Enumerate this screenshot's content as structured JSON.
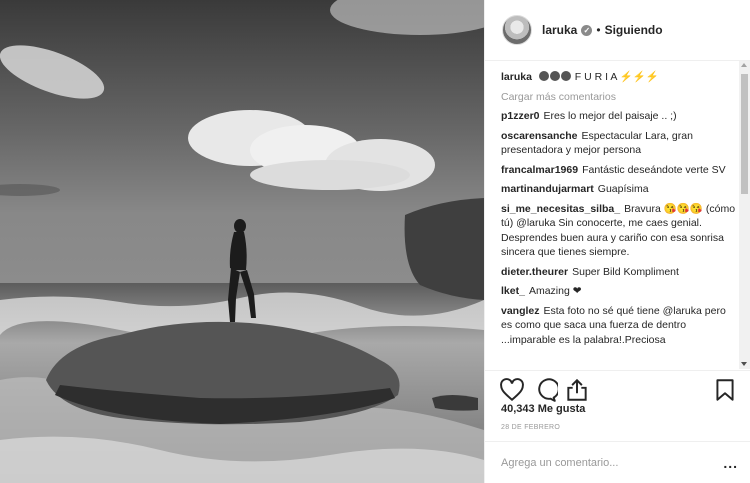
{
  "post": {
    "username": "laruka",
    "verified_icon": "verified-badge-icon",
    "separator": "•",
    "follow_status": "Siguiendo",
    "caption": "F U R I A",
    "caption_prefix_icons": [
      "dark-circle-emoji-icon",
      "dark-circle-emoji-icon",
      "dark-circle-emoji-icon"
    ],
    "caption_suffix_icons": [
      "lightning-emoji-icon",
      "lightning-emoji-icon",
      "lightning-emoji-icon"
    ],
    "load_more": "Cargar más comentarios",
    "comments": [
      {
        "user": "p1zzer0",
        "text": "Eres lo mejor del paisaje .. ;)"
      },
      {
        "user": "oscarensanche",
        "text": "Espectacular Lara, gran presentadora y mejor persona"
      },
      {
        "user": "francalmar1969",
        "text": "Fantástic deseándote verte SV"
      },
      {
        "user": "martinandujarmart",
        "text": "Guapísima"
      },
      {
        "user": "si_me_necesitas_silba_",
        "text": "Bravura 😘😘😘 (cómo tú) @laruka Sin conocerte, me caes genial. Desprendes buen aura y cariño con esa sonrisa sincera que tienes siempre."
      },
      {
        "user": "dieter.theurer",
        "text": "Super Bild Kompliment"
      },
      {
        "user": "lket_",
        "text": "Amazing ❤"
      },
      {
        "user": "vanglez",
        "text": "Esta foto no sé qué tiene @laruka pero es como que saca una fuerza de dentro ...imparable es la palabra!.Preciosa"
      }
    ],
    "likes": "40,343 Me gusta",
    "date": "28 DE FEBRERO",
    "add_comment_placeholder": "Agrega un comentario...",
    "more_options": "..."
  },
  "colors": {
    "text": "#262626",
    "muted": "#999999",
    "border": "#efefef"
  }
}
